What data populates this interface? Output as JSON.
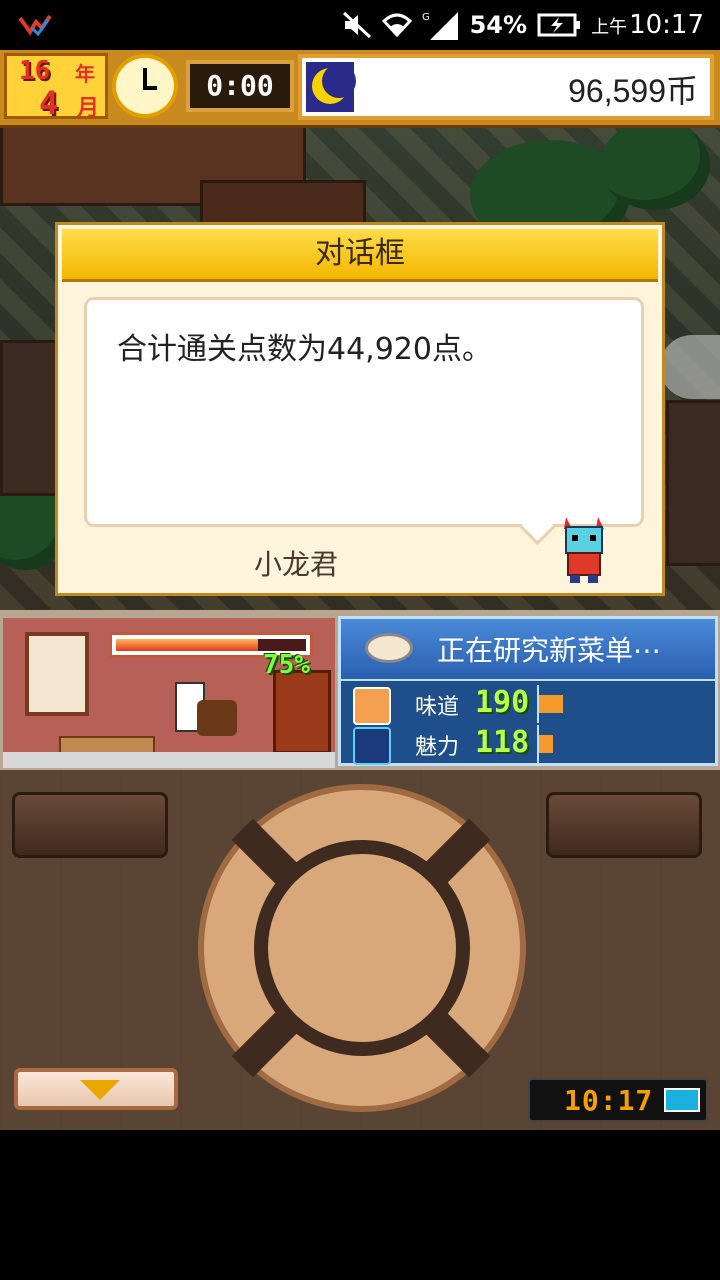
{
  "status_bar": {
    "battery_percent": "54%",
    "ampm": "上午",
    "time": "10:17"
  },
  "hud": {
    "year": "16",
    "year_unit": "年",
    "month": "4",
    "month_unit": "月",
    "game_time": "0:00",
    "money": "96,599币"
  },
  "dialog": {
    "title": "对话框",
    "message": "合计通关点数为44,920点。",
    "speaker": "小龙君"
  },
  "kitchen": {
    "progress_percent": "75%",
    "progress_value": 0.75
  },
  "research": {
    "title": "正在研究新菜单⋯",
    "stats": [
      {
        "label": "味道",
        "value": "190",
        "level": 0.14
      },
      {
        "label": "魅力",
        "value": "118",
        "level": 0.08
      }
    ]
  },
  "device_clock": {
    "time": "10:17"
  },
  "colors": {
    "accent_gold": "#f3b700",
    "research_blue": "#1f4f8a",
    "stat_green": "#b6ff4a",
    "meter_orange": "#f59a2a"
  }
}
